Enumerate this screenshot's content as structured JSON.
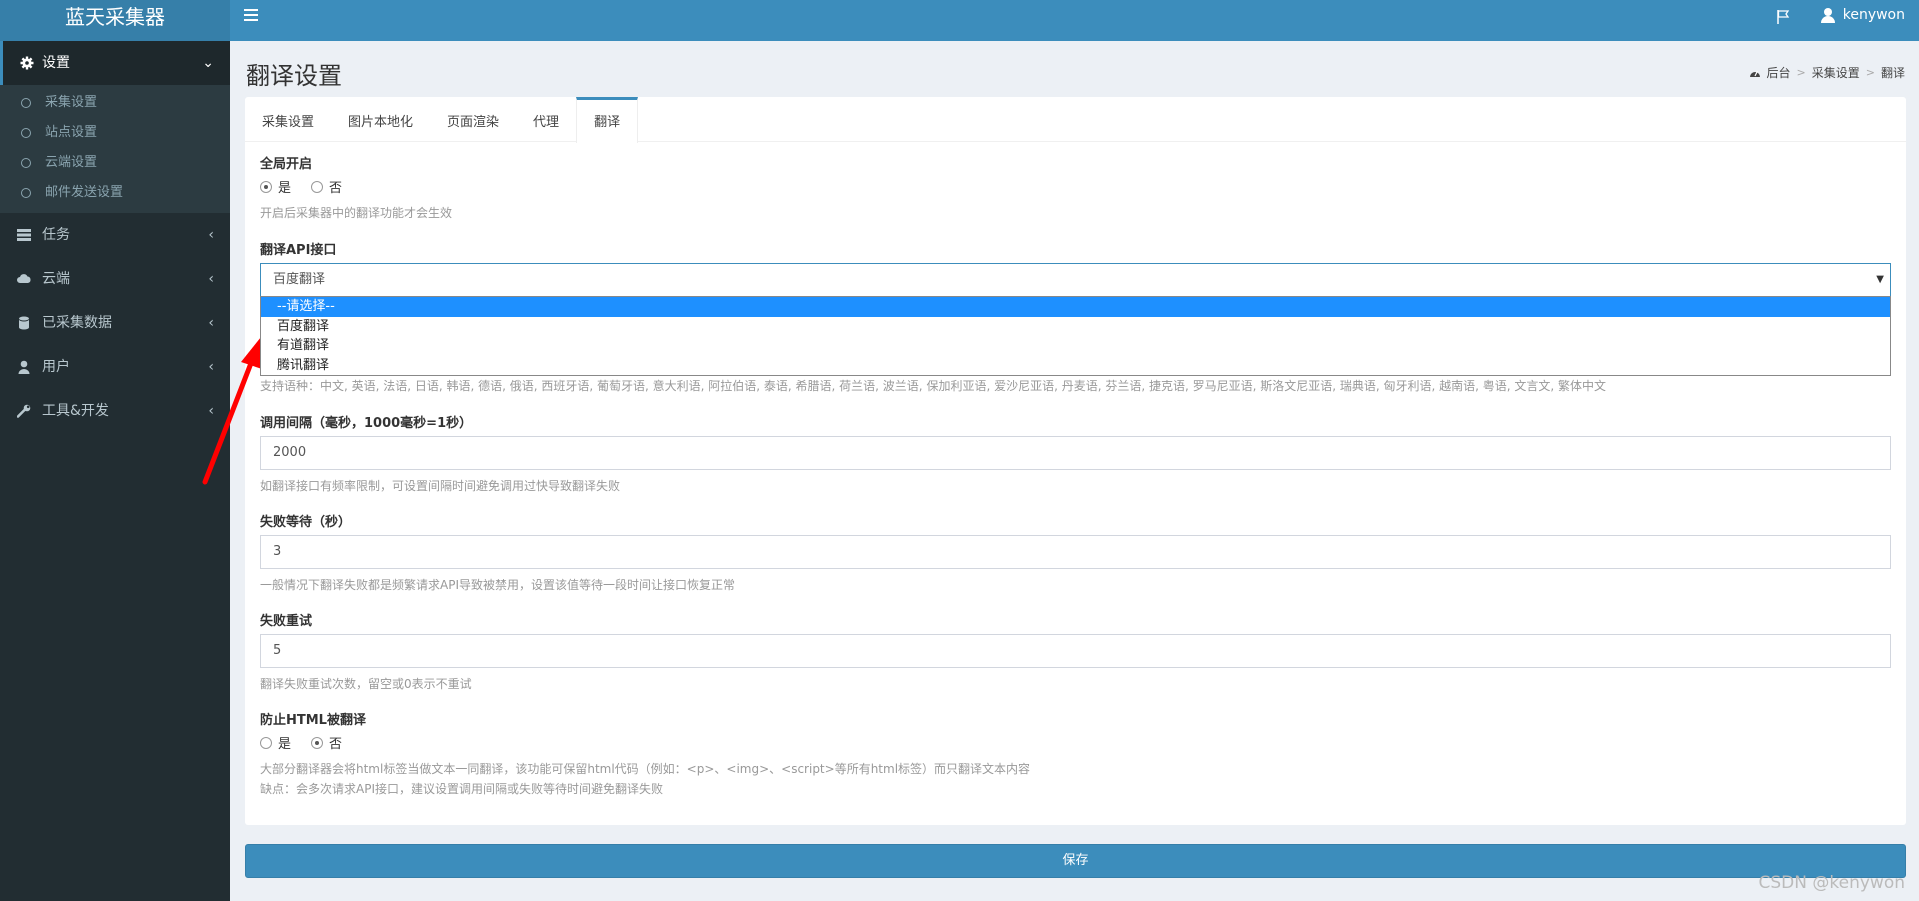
{
  "app": {
    "title": "蓝天采集器"
  },
  "navbar": {
    "username": "kenywon"
  },
  "sidebar": {
    "items": [
      {
        "label": "设置",
        "icon": "gear-icon",
        "active": true,
        "caret": "⌄"
      },
      {
        "label": "任务",
        "icon": "tasks-icon",
        "caret": "‹"
      },
      {
        "label": "云端",
        "icon": "cloud-icon",
        "caret": "‹"
      },
      {
        "label": "已采集数据",
        "icon": "database-icon",
        "caret": "‹"
      },
      {
        "label": "用户",
        "icon": "user-icon",
        "caret": "‹"
      },
      {
        "label": "工具&开发",
        "icon": "wrench-icon",
        "caret": "‹"
      }
    ],
    "submenu": [
      "采集设置",
      "站点设置",
      "云端设置",
      "邮件发送设置"
    ]
  },
  "page": {
    "title": "翻译设置",
    "breadcrumb": [
      "后台",
      "采集设置",
      "翻译"
    ]
  },
  "tabs": [
    "采集设置",
    "图片本地化",
    "页面渲染",
    "代理",
    "翻译"
  ],
  "active_tab": "翻译",
  "form": {
    "global": {
      "label": "全局开启",
      "options": [
        "是",
        "否"
      ],
      "selected": "是",
      "help": "开启后采集器中的翻译功能才会生效"
    },
    "api": {
      "label": "翻译API接口",
      "value": "百度翻译",
      "arrow": "▼",
      "dropdown_options": [
        "--请选择--",
        "百度翻译",
        "有道翻译",
        "腾讯翻译"
      ],
      "highlighted": "--请选择--",
      "languages_help": "支持语种：中文, 英语, 法语, 日语, 韩语, 德语, 俄语, 西班牙语, 葡萄牙语, 意大利语, 阿拉伯语, 泰语, 希腊语, 荷兰语, 波兰语, 保加利亚语, 爱沙尼亚语, 丹麦语, 芬兰语, 捷克语, 罗马尼亚语, 斯洛文尼亚语, 瑞典语, 匈牙利语, 越南语, 粤语, 文言文, 繁体中文"
    },
    "interval": {
      "label": "调用间隔（毫秒，1000毫秒=1秒）",
      "value": "2000",
      "help": "如翻译接口有频率限制，可设置间隔时间避免调用过快导致翻译失败"
    },
    "fail_wait": {
      "label": "失败等待（秒）",
      "value": "3",
      "help": "一般情况下翻译失败都是频繁请求API导致被禁用，设置该值等待一段时间让接口恢复正常"
    },
    "retry": {
      "label": "失败重试",
      "value": "5",
      "help": "翻译失败重试次数，留空或0表示不重试"
    },
    "html_protect": {
      "label": "防止HTML被翻译",
      "options": [
        "是",
        "否"
      ],
      "selected": "否",
      "help1": "大部分翻译器会将html标签当做文本一同翻译，该功能可保留html代码（例如：<p>、<img>、<script>等所有html标签）而只翻译文本内容",
      "help2": "缺点：会多次请求API接口，建议设置调用间隔或失败等待时间避免翻译失败"
    }
  },
  "save_label": "保存",
  "watermark": "CSDN @kenywon",
  "colors": {
    "header": "#3c8dbc",
    "logo": "#367fa9",
    "sidebar": "#222d32",
    "arrow": "#ff0000",
    "dropdown_highlight": "#1e90ff"
  }
}
